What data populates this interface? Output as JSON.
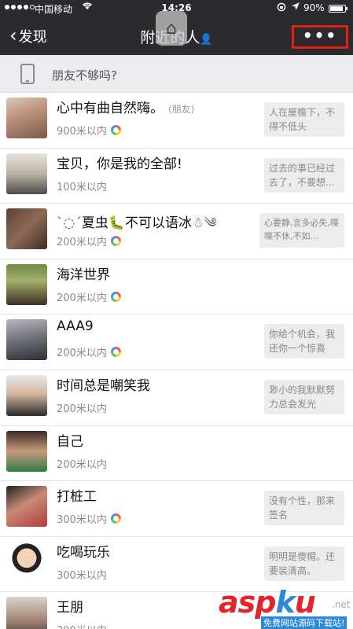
{
  "status": {
    "carrier": "中国移动",
    "time": "14:26",
    "battery": "90%",
    "wifi_icon": "wifi-icon",
    "location_icon": "location-arrow-icon"
  },
  "nav": {
    "back_label": "发现",
    "title": "附近的人",
    "more_label": "•••"
  },
  "banner": {
    "text": "朋友不够吗?"
  },
  "people": [
    {
      "name": "心中有曲自然嗨。",
      "tag": "(朋友)",
      "distance": "900米以内",
      "moments": true,
      "signature": "人在屋檐下，不得不低头"
    },
    {
      "name": "宝贝，你是我的全部!",
      "tag": "",
      "distance": "100米以内",
      "moments": false,
      "signature": "过去的事已经过去了，不要想..."
    },
    {
      "name": "夏虫",
      "name_suffix": "不可以语冰",
      "tag": "",
      "distance": "200米以内",
      "moments": true,
      "signature": "心要静,言多必失,喋喋不休,不如..."
    },
    {
      "name": "海洋世界",
      "tag": "",
      "distance": "200米以内",
      "moments": true,
      "signature": ""
    },
    {
      "name": "AAA9",
      "tag": "",
      "distance": "200米以内",
      "moments": true,
      "signature": "你给个机会，我还你一个惊喜"
    },
    {
      "name": "时间总是嘲笑我",
      "tag": "",
      "distance": "200米以内",
      "moments": false,
      "signature": "渺小的我默默努力总会发光"
    },
    {
      "name": "自己",
      "tag": "",
      "distance": "200米以内",
      "moments": false,
      "signature": ""
    },
    {
      "name": "打桩工",
      "tag": "",
      "distance": "300米以内",
      "moments": true,
      "signature": "没有个性，那来签名"
    },
    {
      "name": "吃喝玩乐",
      "tag": "",
      "distance": "300米以内",
      "moments": false,
      "signature": "明明是傻帽。还要装清高。"
    },
    {
      "name": "王朋",
      "tag": "",
      "distance": "300米以内",
      "moments": false,
      "signature": ""
    }
  ],
  "watermark": {
    "brand_a": "asp",
    "brand_b": "k",
    "brand_c": "u",
    "net": ".net",
    "sub": "免费网站源码下载站!"
  },
  "colors": {
    "nav_bg": "#2b2b2f",
    "highlight_border": "#e0221b",
    "brand_red": "#e5232a",
    "brand_blue": "#2c88d9"
  }
}
